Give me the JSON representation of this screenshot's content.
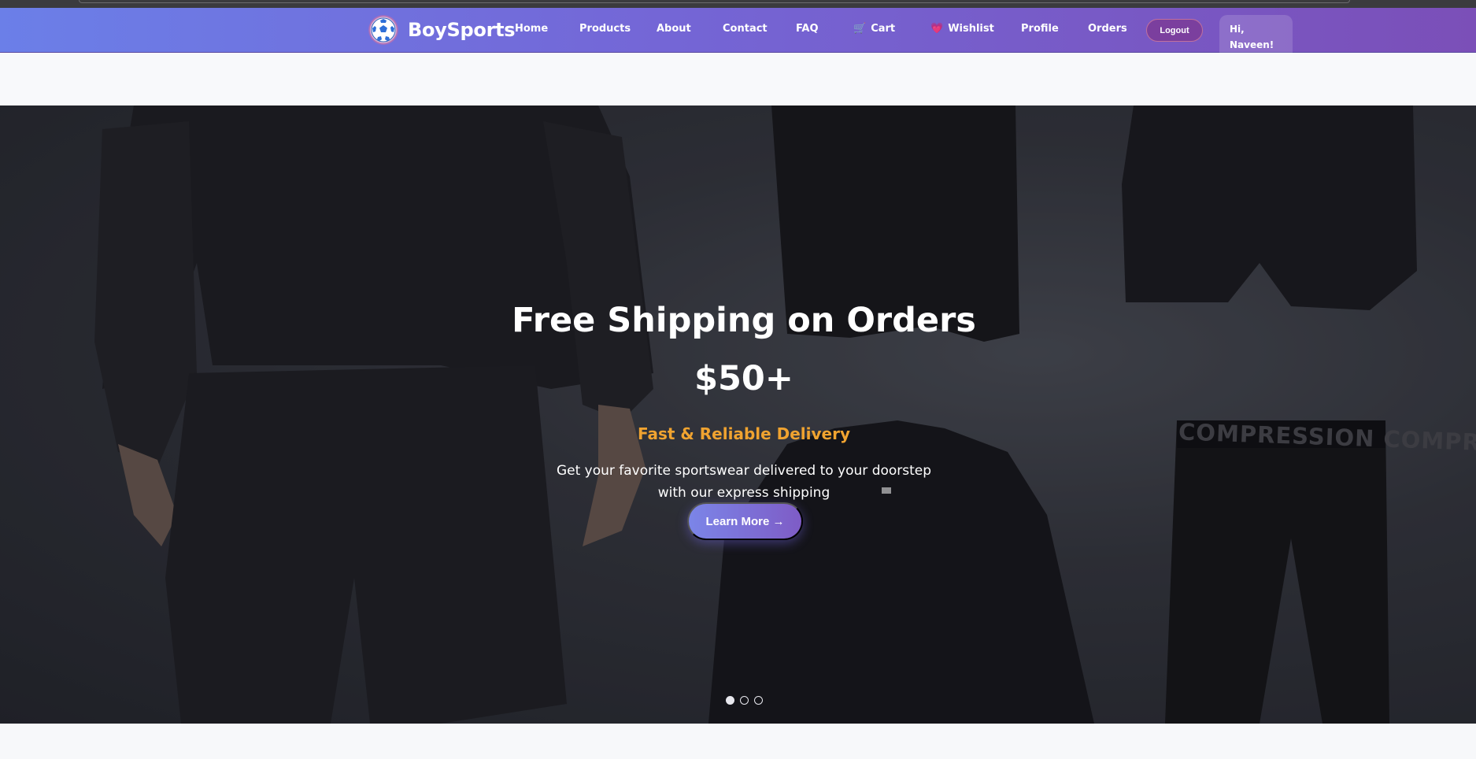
{
  "nav": {
    "brand": "BoySports",
    "links": [
      {
        "label": "Home",
        "icon": ""
      },
      {
        "label": "Products",
        "icon": ""
      },
      {
        "label": "About",
        "icon": ""
      },
      {
        "label": "Contact",
        "icon": ""
      },
      {
        "label": "FAQ",
        "icon": ""
      },
      {
        "label": "Cart",
        "icon": "🛒"
      },
      {
        "label": "Wishlist",
        "icon": "💗"
      },
      {
        "label": "Profile",
        "icon": ""
      },
      {
        "label": "Orders",
        "icon": ""
      }
    ],
    "logout": "Logout",
    "greeting_line1": "Hi,",
    "greeting_line2": "Naveen!"
  },
  "hero": {
    "title_line1": "Free Shipping on Orders",
    "title_line2": "$50+",
    "subtitle": "Fast & Reliable Delivery",
    "description": "Get your favorite sportswear delivered to your doorstep with our express shipping",
    "button": "Learn More →",
    "slides": 3,
    "active_slide": 1,
    "image_text": "COMPRESSION COMPRESSION"
  },
  "colors": {
    "nav_gradient_start": "#6b7fe8",
    "nav_gradient_end": "#7b4fb8",
    "accent_orange": "#f0a330",
    "button_gradient_start": "#7b85e8",
    "button_gradient_end": "#7e5cc6"
  },
  "icons": {
    "logo": "soccer-ball-icon",
    "cart": "cart-icon",
    "wishlist": "heart-icon"
  }
}
